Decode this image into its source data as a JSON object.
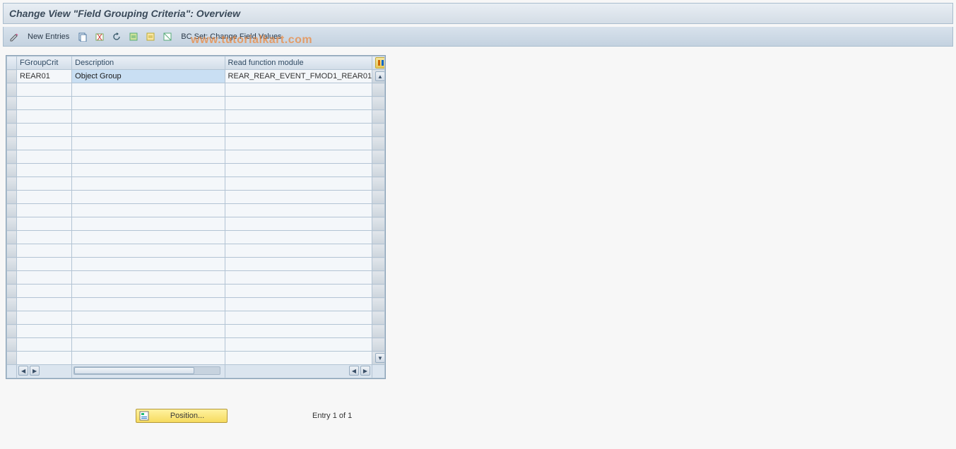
{
  "header": {
    "title": "Change View \"Field Grouping Criteria\": Overview"
  },
  "toolbar": {
    "new_entries": "New Entries",
    "bc_set": "BC Set: Change Field Values"
  },
  "table": {
    "columns": {
      "fgroupcrit": "FGroupCrit",
      "description": "Description",
      "read_fm": "Read function module"
    },
    "rows": [
      {
        "fgroupcrit": "REAR01",
        "description": "Object Group",
        "read_fm": "REAR_REAR_EVENT_FMOD1_REAR01"
      }
    ]
  },
  "footer": {
    "position_label": "Position...",
    "entry_text": "Entry 1 of 1"
  },
  "watermark": "www.tutorialkart.com"
}
